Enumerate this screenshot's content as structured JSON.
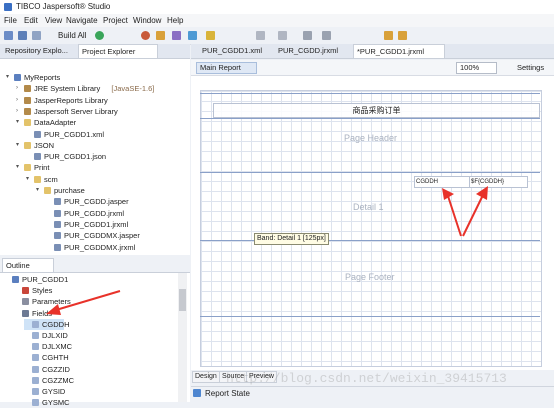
{
  "window": {
    "title": "TIBCO Jaspersoft® Studio"
  },
  "menu": [
    "File",
    "Edit",
    "View",
    "Navigate",
    "Project",
    "Window",
    "Help"
  ],
  "toolbar": {
    "build_all": "Build All"
  },
  "left_tabs": {
    "repository": "Repository Explo...",
    "project": "Project Explorer"
  },
  "project_tree": [
    {
      "label": "MyReports",
      "level": 0,
      "icon": "project-icon",
      "expanded": true
    },
    {
      "label": "JRE System Library",
      "suffix": "[JavaSE-1.6]",
      "level": 1,
      "icon": "library-icon"
    },
    {
      "label": "JasperReports Library",
      "level": 1,
      "icon": "library-icon"
    },
    {
      "label": "Jaspersoft Server Library",
      "level": 1,
      "icon": "library-icon"
    },
    {
      "label": "DataAdapter",
      "level": 1,
      "icon": "folder-icon",
      "expanded": true
    },
    {
      "label": "PUR_CGDD1.xml",
      "level": 2,
      "icon": "file-icon"
    },
    {
      "label": "JSON",
      "level": 1,
      "icon": "folder-icon",
      "expanded": true
    },
    {
      "label": "PUR_CGDD1.json",
      "level": 2,
      "icon": "file-icon"
    },
    {
      "label": "Print",
      "level": 1,
      "icon": "folder-icon",
      "expanded": true
    },
    {
      "label": "scm",
      "level": 2,
      "icon": "folder-icon",
      "expanded": true
    },
    {
      "label": "purchase",
      "level": 3,
      "icon": "folder-icon",
      "expanded": true
    },
    {
      "label": "PUR_CGDD.jasper",
      "level": 4,
      "icon": "file-icon"
    },
    {
      "label": "PUR_CGDD.jrxml",
      "level": 4,
      "icon": "file-icon"
    },
    {
      "label": "PUR_CGDD1.jrxml",
      "level": 4,
      "icon": "file-icon"
    },
    {
      "label": "PUR_CGDDMX.jasper",
      "level": 4,
      "icon": "file-icon"
    },
    {
      "label": "PUR_CGDDMX.jrxml",
      "level": 4,
      "icon": "file-icon"
    }
  ],
  "outline": {
    "tab": "Outline",
    "rows": [
      {
        "label": "PUR_CGDD1",
        "level": 0
      },
      {
        "label": "Styles",
        "level": 1
      },
      {
        "label": "Parameters",
        "level": 1
      },
      {
        "label": "Fields",
        "level": 1
      },
      {
        "label": "CGDDH",
        "level": 2,
        "selected": true
      },
      {
        "label": "DJLXID",
        "level": 2
      },
      {
        "label": "DJLXMC",
        "level": 2
      },
      {
        "label": "CGHTH",
        "level": 2
      },
      {
        "label": "CGZZID",
        "level": 2
      },
      {
        "label": "CGZZMC",
        "level": 2
      },
      {
        "label": "GYSID",
        "level": 2
      },
      {
        "label": "GYSMC",
        "level": 2
      }
    ]
  },
  "editor_tabs": [
    "PUR_CGDD1.xml",
    "PUR_CGDD.jrxml",
    "*PUR_CGDD1.jrxml"
  ],
  "editor": {
    "main_report": "Main Report",
    "zoom": "100%",
    "settings": "Settings",
    "title_text": "商品采购订单",
    "page_header": "Page Header",
    "detail": "Detail 1",
    "page_footer": "Page Footer",
    "field_label": "CGDDH",
    "field_expr": "$F{CGDDH}",
    "tooltip": "Band: Detail 1 [125px]"
  },
  "bottom_tabs": [
    "Design",
    "Source",
    "Preview"
  ],
  "report_state": "Report State",
  "watermark": "http://blog.csdn.net/weixin_39415713",
  "colors": {
    "arrow": "#e8322a",
    "selection": "#cfe3f7",
    "band_line": "#8aa0c8"
  }
}
